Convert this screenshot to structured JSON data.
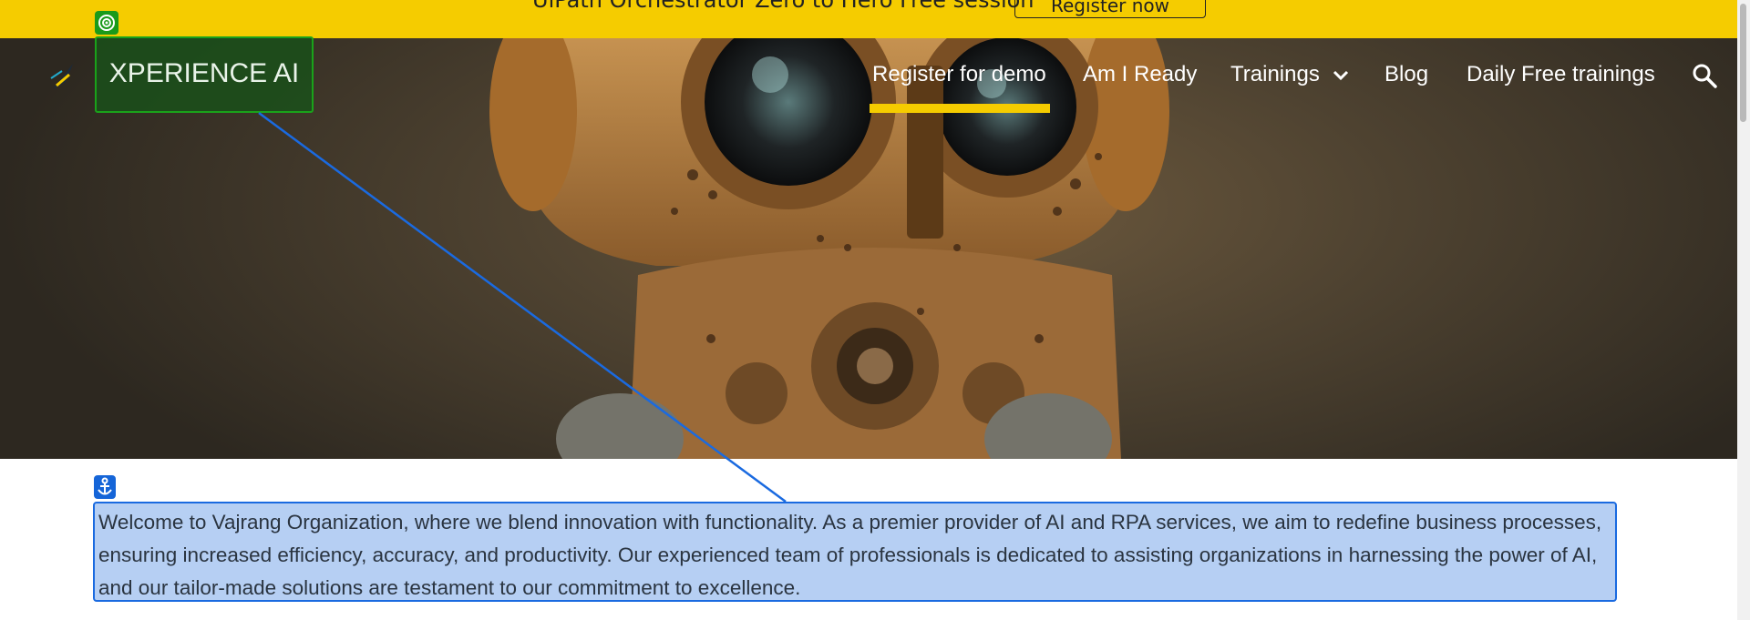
{
  "banner": {
    "text": "UiPath Orchestrator Zero to Hero Free session",
    "button": "Register now"
  },
  "brand": {
    "name": "XPERIENCE AI"
  },
  "nav": {
    "items": [
      {
        "label": "Register for demo"
      },
      {
        "label": "Am I Ready"
      },
      {
        "label": "Trainings"
      },
      {
        "label": "Blog"
      },
      {
        "label": "Daily Free trainings"
      }
    ]
  },
  "content": {
    "intro": "Welcome to Vajrang Organization, where we blend innovation with functionality. As a premier provider of AI and RPA services, we aim to redefine business processes, ensuring increased efficiency, accuracy, and productivity. Our experienced team of professionals is dedicated to assisting organizations in harnessing the power of AI, and our tailor-made solutions are testament to our commitment to excellence."
  },
  "icons": {
    "target": "target-icon",
    "anchor": "anchor-icon",
    "search": "search-icon",
    "chevron": "chevron-down-icon",
    "logo": "logo-icon"
  },
  "colors": {
    "banner": "#f5cc00",
    "underline": "#f5cc00",
    "target_highlight": "#1aa21a",
    "anchor_highlight": "#1a6ae0"
  }
}
